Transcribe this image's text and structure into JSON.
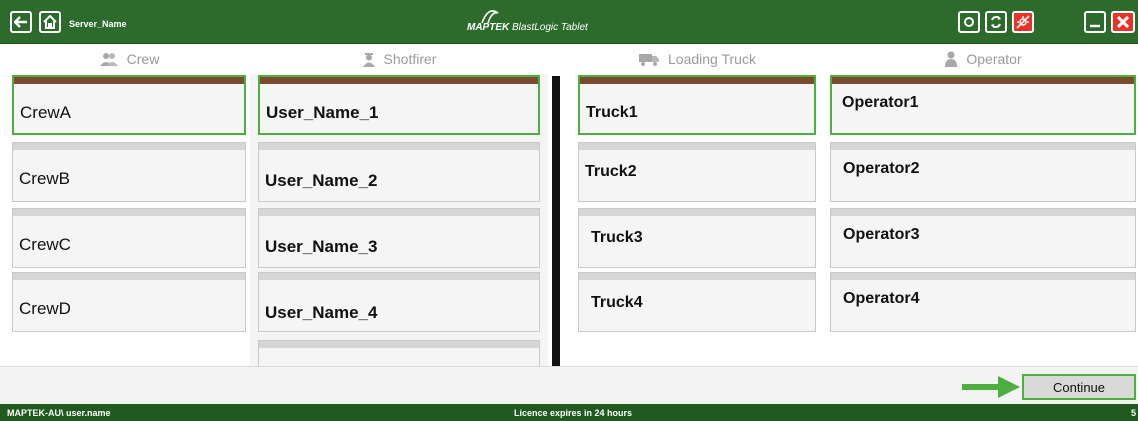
{
  "titlebar": {
    "server_name": "Server_Name",
    "brand_logo": "MAPTEK",
    "brand_product": "BlastLogic Tablet",
    "icons": [
      "back-arrow-icon",
      "home-icon",
      "sync-icon",
      "refresh-icon",
      "gps-off-icon",
      "minimize-icon",
      "close-icon"
    ]
  },
  "columns": {
    "crew": {
      "header": "Crew",
      "icon": "people-icon",
      "items": [
        "CrewA",
        "CrewB",
        "CrewC",
        "CrewD"
      ],
      "selected": "CrewA"
    },
    "shotfirer": {
      "header": "Shotfirer",
      "icon": "shotfirer-icon",
      "items": [
        "User_Name_1",
        "User_Name_2",
        "User_Name_3",
        "User_Name_4"
      ],
      "selected": "User_Name_1"
    },
    "loading_truck": {
      "header": "Loading Truck",
      "icon": "truck-icon",
      "items": [
        "Truck1",
        "Truck2",
        "Truck3",
        "Truck4"
      ],
      "selected": "Truck1"
    },
    "operator": {
      "header": "Operator",
      "icon": "person-icon",
      "items": [
        "Operator1",
        "Operator2",
        "Operator3",
        "Operator4"
      ],
      "selected": "Operator1"
    }
  },
  "footer": {
    "continue_label": "Continue"
  },
  "statusbar": {
    "user": "MAPTEK-AU\\ user.name",
    "licence": "Licence expires in 24 hours",
    "right_value": "5"
  },
  "colors": {
    "titlebar": "#2d6b2d",
    "selected_border": "#4caf3f",
    "selected_bar": "#7a4b2e",
    "close_red": "#e8322a"
  }
}
